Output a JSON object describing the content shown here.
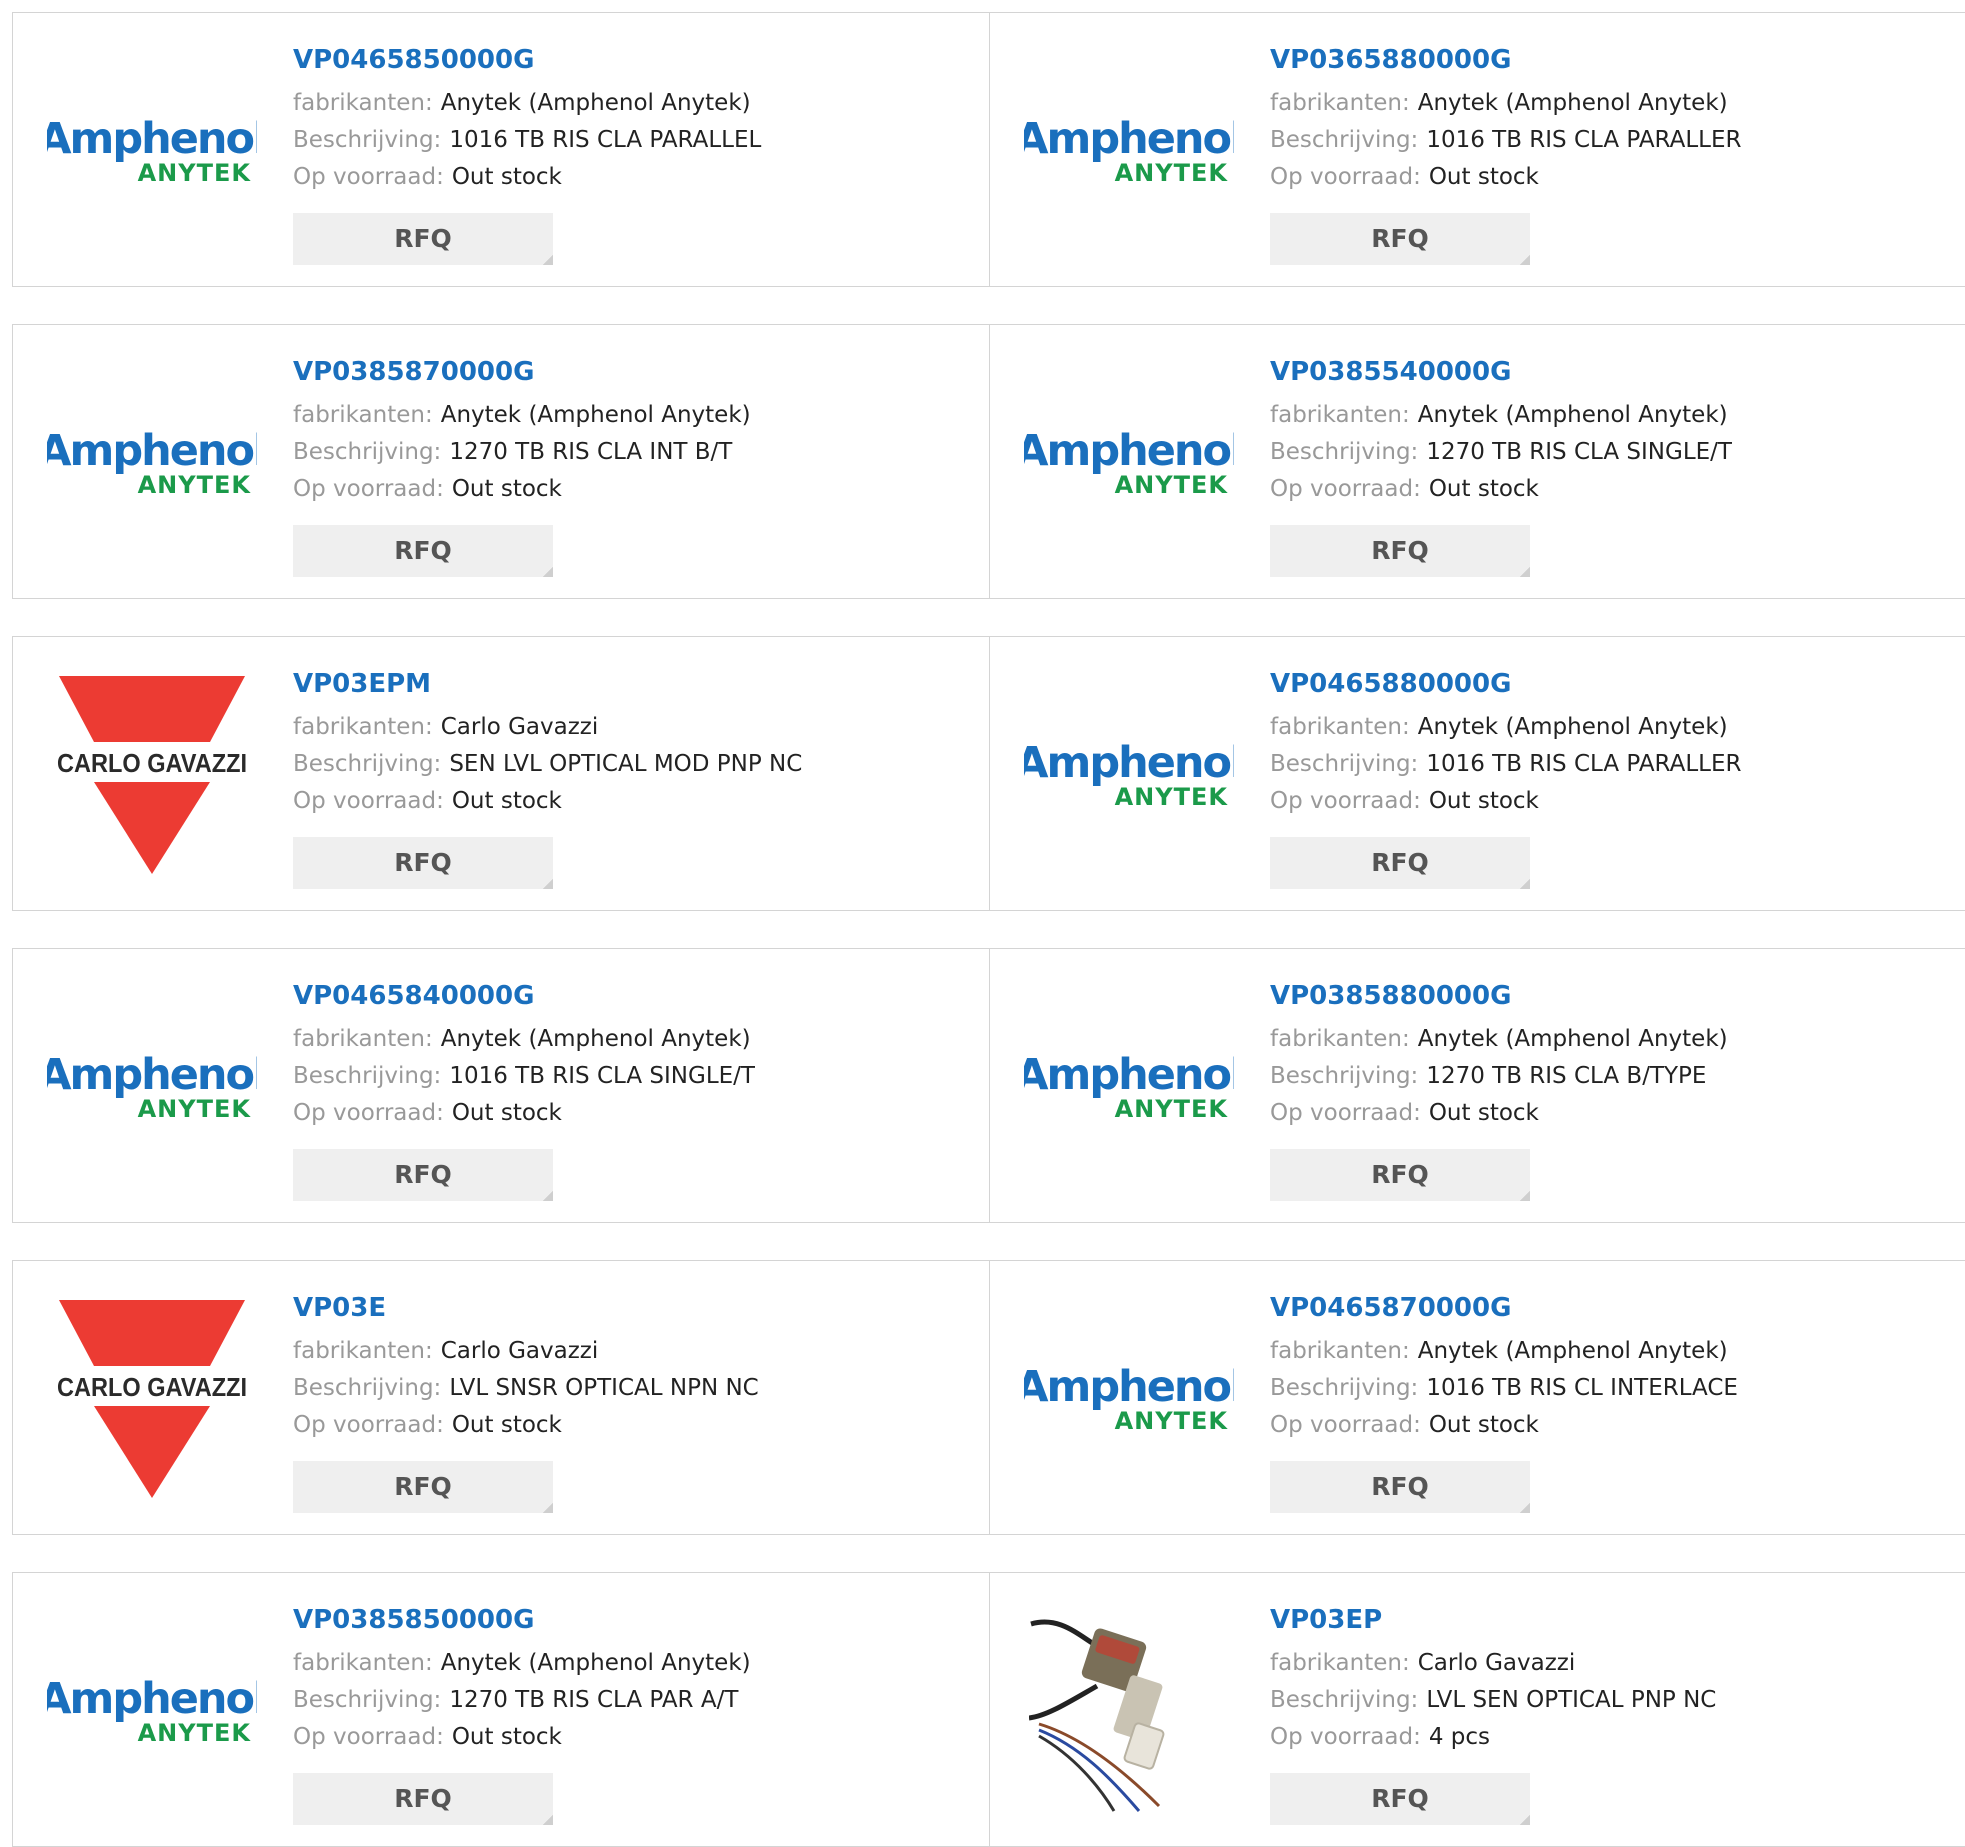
{
  "labels": {
    "manufacturer": "fabrikanten:",
    "description": "Beschrijving:",
    "stock": "Op voorraad:"
  },
  "products": [
    {
      "part": "VP0465850000G",
      "manufacturer": "Anytek (Amphenol Anytek)",
      "description": "1016 TB RIS CLA PARALLEL",
      "stock": "Out stock",
      "logo": "amphenol",
      "rfq": "RFQ"
    },
    {
      "part": "VP0365880000G",
      "manufacturer": "Anytek (Amphenol Anytek)",
      "description": "1016 TB RIS CLA PARALLER",
      "stock": "Out stock",
      "logo": "amphenol",
      "rfq": "RFQ"
    },
    {
      "part": "VP0385870000G",
      "manufacturer": "Anytek (Amphenol Anytek)",
      "description": "1270 TB RIS CLA INT B/T",
      "stock": "Out stock",
      "logo": "amphenol",
      "rfq": "RFQ"
    },
    {
      "part": "VP0385540000G",
      "manufacturer": "Anytek (Amphenol Anytek)",
      "description": "1270 TB RIS CLA SINGLE/T",
      "stock": "Out stock",
      "logo": "amphenol",
      "rfq": "RFQ"
    },
    {
      "part": "VP03EPM",
      "manufacturer": "Carlo Gavazzi",
      "description": "SEN LVL OPTICAL MOD PNP NC",
      "stock": "Out stock",
      "logo": "carlo",
      "rfq": "RFQ"
    },
    {
      "part": "VP0465880000G",
      "manufacturer": "Anytek (Amphenol Anytek)",
      "description": "1016 TB RIS CLA PARALLER",
      "stock": "Out stock",
      "logo": "amphenol",
      "rfq": "RFQ"
    },
    {
      "part": "VP0465840000G",
      "manufacturer": "Anytek (Amphenol Anytek)",
      "description": "1016 TB RIS CLA SINGLE/T",
      "stock": "Out stock",
      "logo": "amphenol",
      "rfq": "RFQ"
    },
    {
      "part": "VP0385880000G",
      "manufacturer": "Anytek (Amphenol Anytek)",
      "description": "1270 TB RIS CLA B/TYPE",
      "stock": "Out stock",
      "logo": "amphenol",
      "rfq": "RFQ"
    },
    {
      "part": "VP03E",
      "manufacturer": "Carlo Gavazzi",
      "description": "LVL SNSR OPTICAL NPN NC",
      "stock": "Out stock",
      "logo": "carlo",
      "rfq": "RFQ"
    },
    {
      "part": "VP0465870000G",
      "manufacturer": "Anytek (Amphenol Anytek)",
      "description": "1016 TB RIS CL INTERLACE",
      "stock": "Out stock",
      "logo": "amphenol",
      "rfq": "RFQ"
    },
    {
      "part": "VP0385850000G",
      "manufacturer": "Anytek (Amphenol Anytek)",
      "description": "1270 TB RIS CLA PAR A/T",
      "stock": "Out stock",
      "logo": "amphenol",
      "rfq": "RFQ"
    },
    {
      "part": "VP03EP",
      "manufacturer": "Carlo Gavazzi",
      "description": "LVL SEN OPTICAL PNP NC",
      "stock": "4 pcs",
      "logo": "sensor-photo",
      "rfq": "RFQ"
    }
  ],
  "logos": {
    "amphenol": {
      "line1": "Amphenol",
      "line2": "ANYTEK",
      "color1": "#1a6fbd",
      "color2": "#1b9a4a"
    },
    "carlo": {
      "text": "CARLO GAVAZZI",
      "color": "#ec3b33"
    }
  },
  "colors": {
    "part_link": "#1a6fbd",
    "label": "#999999",
    "value": "#222222",
    "rfq_bg": "#efefef"
  }
}
